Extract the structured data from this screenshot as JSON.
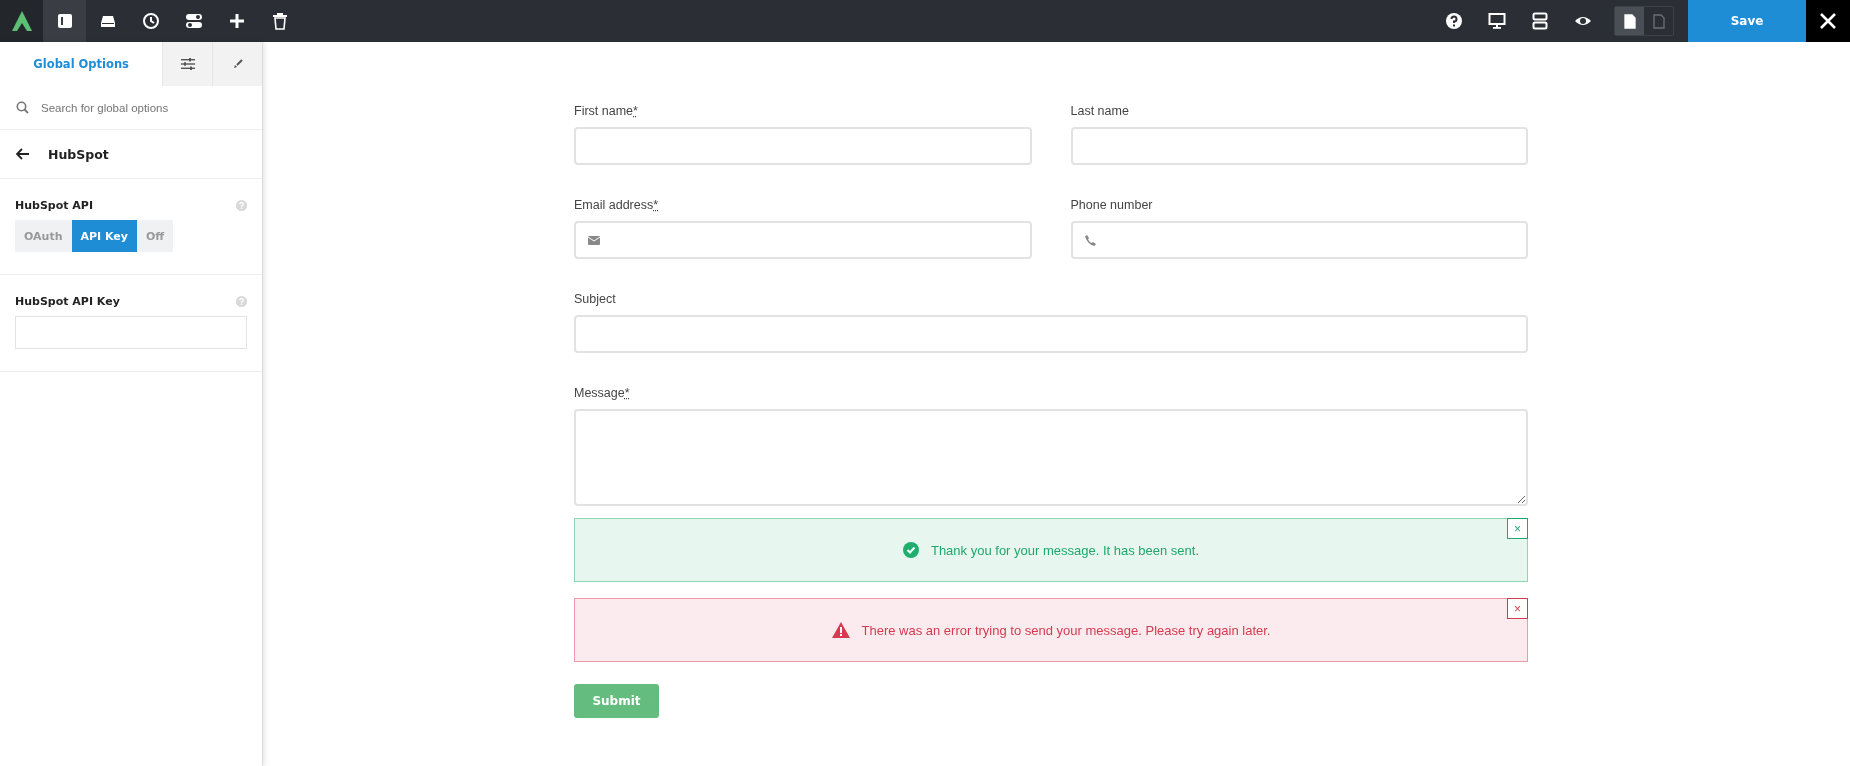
{
  "toolbar": {
    "left_tools": [
      {
        "kind": "panel",
        "selected": true
      },
      {
        "kind": "drive",
        "selected": false
      },
      {
        "kind": "clock",
        "selected": false
      },
      {
        "kind": "toggles",
        "selected": false
      },
      {
        "kind": "plus",
        "selected": false
      },
      {
        "kind": "trash",
        "selected": false
      }
    ],
    "right_tools": [
      {
        "kind": "help"
      },
      {
        "kind": "monitor"
      },
      {
        "kind": "rows"
      },
      {
        "kind": "eye"
      }
    ],
    "page_views": [
      {
        "selected": true
      },
      {
        "selected": false
      }
    ],
    "save_label": "Save"
  },
  "sidebar": {
    "tabs": [
      {
        "kind": "text",
        "label": "Global Options",
        "selected": true
      },
      {
        "kind": "sliders",
        "selected": false
      },
      {
        "kind": "brush",
        "selected": false
      }
    ],
    "search": {
      "placeholder": "Search for global options"
    },
    "back_title": "HubSpot",
    "settings": [
      {
        "kind": "segmented",
        "label": "HubSpot API",
        "options": [
          {
            "label": "OAuth",
            "selected": false
          },
          {
            "label": "API Key",
            "selected": true
          },
          {
            "label": "Off",
            "selected": false
          }
        ]
      },
      {
        "kind": "text",
        "label": "HubSpot API Key"
      }
    ]
  },
  "form": {
    "rows": [
      [
        {
          "kind": "plain",
          "label": "First name",
          "required": true
        },
        {
          "kind": "plain",
          "label": "Last name",
          "required": false
        }
      ],
      [
        {
          "kind": "email",
          "label": "Email address",
          "required": true
        },
        {
          "kind": "phone",
          "label": "Phone number",
          "required": false
        }
      ],
      [
        {
          "kind": "plain",
          "label": "Subject",
          "required": false
        }
      ]
    ],
    "required_mark": "*",
    "message": {
      "label": "Message",
      "required": true
    },
    "alerts": [
      {
        "kind": "success",
        "text": "Thank you for your message. It has been sent.",
        "close": "×"
      },
      {
        "kind": "error",
        "text": "There was an error trying to send your message. Please try again later.",
        "close": "×"
      }
    ],
    "submit": "Submit"
  }
}
